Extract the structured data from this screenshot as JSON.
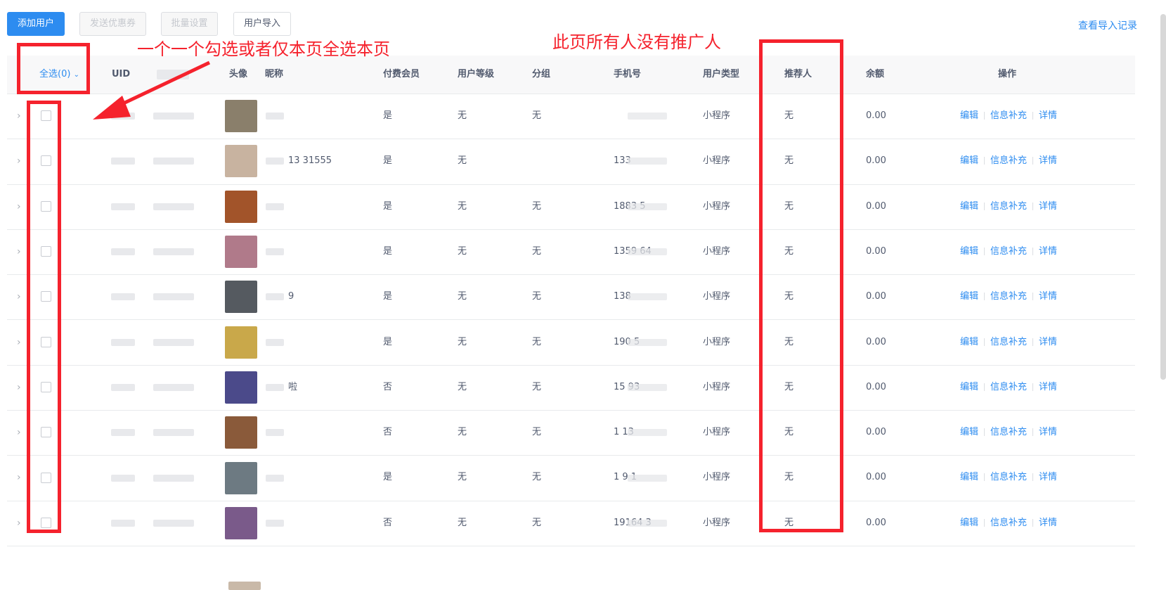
{
  "toolbar": {
    "add_user": "添加用户",
    "send_coupon": "发送优惠券",
    "batch_settings": "批量设置",
    "user_import": "用户导入",
    "view_import_records": "查看导入记录"
  },
  "annotations": {
    "select_hint": "一个一个勾选或者仅本页全选本页",
    "no_referrer_hint": "此页所有人没有推广人"
  },
  "table": {
    "headers": {
      "select_all": "全选(0)",
      "uid": "UID",
      "avatar": "头像",
      "nickname": "昵称",
      "paid_member": "付费会员",
      "user_level": "用户等级",
      "group": "分组",
      "phone": "手机号",
      "user_type": "用户类型",
      "referrer": "推荐人",
      "balance": "余额",
      "actions": "操作"
    },
    "ops": {
      "edit": "编辑",
      "info_fill": "信息补充",
      "detail": "详情"
    },
    "rows": [
      {
        "nickname": "",
        "paid": "是",
        "level": "无",
        "group": "无",
        "phone": "",
        "type": "小程序",
        "referrer": "无",
        "balance": "0.00",
        "avatar_color": "#8a7f6b"
      },
      {
        "nickname": "13       31555",
        "paid": "是",
        "level": "无",
        "group": "",
        "phone": "133",
        "type": "小程序",
        "referrer": "无",
        "balance": "0.00",
        "avatar_color": "#c8b3a0"
      },
      {
        "nickname": "",
        "paid": "是",
        "level": "无",
        "group": "无",
        "phone": "1883         5",
        "type": "小程序",
        "referrer": "无",
        "balance": "0.00",
        "avatar_color": "#a2542a"
      },
      {
        "nickname": "",
        "paid": "是",
        "level": "无",
        "group": "无",
        "phone": "1359       64",
        "type": "小程序",
        "referrer": "无",
        "balance": "0.00",
        "avatar_color": "#b07a8a"
      },
      {
        "nickname": "9",
        "paid": "是",
        "level": "无",
        "group": "无",
        "phone": "138",
        "type": "小程序",
        "referrer": "无",
        "balance": "0.00",
        "avatar_color": "#555a60"
      },
      {
        "nickname": "",
        "paid": "是",
        "level": "无",
        "group": "无",
        "phone": "190       5",
        "type": "小程序",
        "referrer": "无",
        "balance": "0.00",
        "avatar_color": "#c9a84a"
      },
      {
        "nickname": "啦",
        "paid": "否",
        "level": "无",
        "group": "无",
        "phone": "15     93",
        "type": "小程序",
        "referrer": "无",
        "balance": "0.00",
        "avatar_color": "#4b4a8a"
      },
      {
        "nickname": "",
        "paid": "否",
        "level": "无",
        "group": "无",
        "phone": "1     13",
        "type": "小程序",
        "referrer": "无",
        "balance": "0.00",
        "avatar_color": "#8a5a3a"
      },
      {
        "nickname": "",
        "paid": "是",
        "level": "无",
        "group": "无",
        "phone": "1       9    1",
        "type": "小程序",
        "referrer": "无",
        "balance": "0.00",
        "avatar_color": "#6d7a82"
      },
      {
        "nickname": "",
        "paid": "否",
        "level": "无",
        "group": "无",
        "phone": "19164       3",
        "type": "小程序",
        "referrer": "无",
        "balance": "0.00",
        "avatar_color": "#7a5a8a"
      }
    ]
  }
}
